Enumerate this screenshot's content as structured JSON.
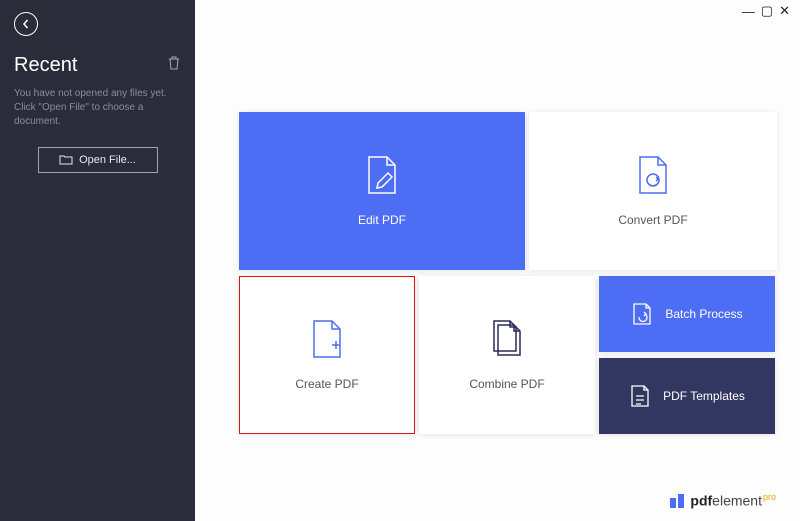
{
  "sidebar": {
    "title": "Recent",
    "empty_message": "You have not opened any files yet. Click \"Open File\" to choose a document.",
    "open_file_label": "Open File..."
  },
  "tiles": {
    "edit": "Edit PDF",
    "convert": "Convert PDF",
    "create": "Create PDF",
    "combine": "Combine PDF",
    "batch": "Batch Process",
    "templates": "PDF Templates"
  },
  "brand": {
    "name_bold": "pdf",
    "name_rest": "element",
    "edition": "pro"
  },
  "window_controls": {
    "minimize": "—",
    "maximize": "▢",
    "close": "✕"
  }
}
